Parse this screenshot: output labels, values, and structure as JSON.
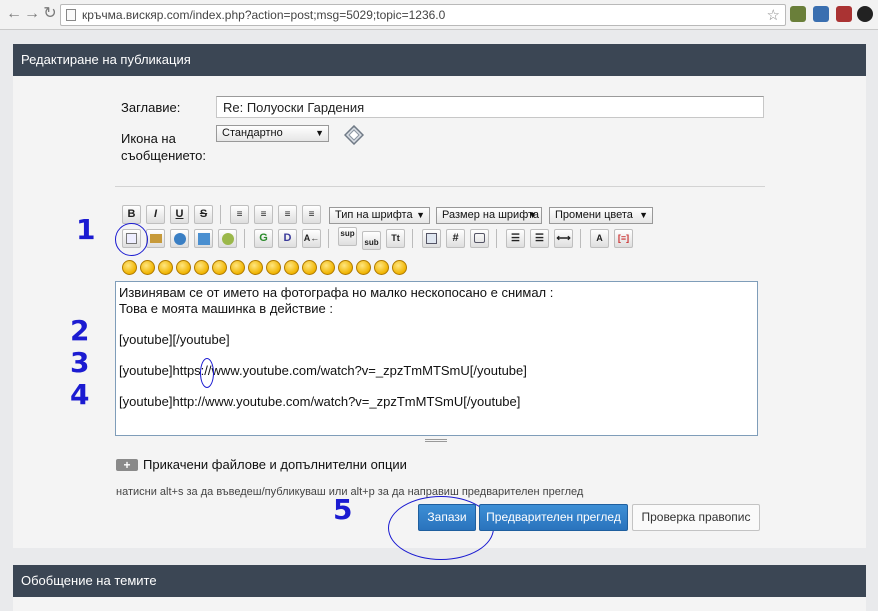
{
  "browser": {
    "url": "кръчма.вискяр.com/index.php?action=post;msg=5029;topic=1236.0"
  },
  "edit_panel": {
    "header": "Редактиране на публикация",
    "subject_label": "Заглавие:",
    "subject_value": "Re: Полуоски Гардения",
    "icon_label_line1": "Икона на",
    "icon_label_line2": "съобщението:",
    "icon_select_value": "Стандартно"
  },
  "toolbar": {
    "font_face_select": "Тип на шрифта",
    "font_size_select": "Размер на шрифта",
    "font_color_select": "Промени цвета",
    "bold": "B",
    "italic": "I",
    "underline": "U",
    "strike": "S",
    "sup": "sup",
    "sub": "sub",
    "hash": "#"
  },
  "editor": {
    "lines": [
      "Извинявам се от името на фотографа но малко нескопосано е снимал :",
      "Това е моята машинка в действие :",
      "",
      "[youtube][/youtube]",
      "",
      "[youtube]https://www.youtube.com/watch?v=_zpzTmMTSmU[/youtube]",
      "",
      "[youtube]http://www.youtube.com/watch?v=_zpzTmMTSmU[/youtube]"
    ]
  },
  "attachments": {
    "toggle": "+",
    "label": "Прикачени файлове и допълнителни опции"
  },
  "hint": "натисни alt+s за да въведеш/публикуваш или alt+p за да направиш предварителен преглед",
  "buttons": {
    "save": "Запази",
    "preview": "Предварителен преглед",
    "spellcheck": "Проверка правопис"
  },
  "summary_panel": {
    "header": "Обобщение на темите"
  },
  "annotations": [
    "1",
    "2",
    "3",
    "4",
    "5"
  ],
  "colors": {
    "header_bg": "#3b4654",
    "primary_button": "#2f7fc8",
    "annotation": "#1b1bd1"
  }
}
